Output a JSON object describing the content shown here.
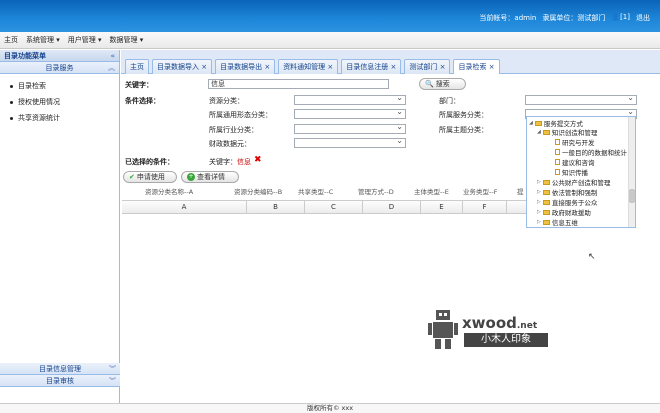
{
  "topbar": {
    "account_label": "当前帐号：",
    "account": "admin",
    "unit_label": "隶属单位：",
    "unit": "测试部门",
    "user_count": "[1]",
    "logout": "退出"
  },
  "menu": {
    "items": [
      "主页",
      "系统管理 ▾",
      "用户管理 ▾",
      "数据管理 ▾"
    ]
  },
  "sidebar": {
    "title": "目录功能菜单",
    "section": "目录服务",
    "items": [
      "目录检索",
      "授权使用情况",
      "共享资源统计"
    ],
    "bottom": [
      "目录信息管理",
      "目录审核"
    ]
  },
  "tabs": [
    {
      "label": "主页"
    },
    {
      "label": "目录数据导入 ×"
    },
    {
      "label": "目录数据导出 ×"
    },
    {
      "label": "资料通知管理 ×"
    },
    {
      "label": "目录信息注册 ×"
    },
    {
      "label": "测试部门 ×"
    },
    {
      "label": "目录检索 ×"
    }
  ],
  "form": {
    "keyword_label": "关键字：",
    "keyword_value": "信息",
    "search_btn": "搜索",
    "cond_label": "条件选择：",
    "res_cat": "资源分类：",
    "org_form": "所属通用形态分类：",
    "industry": "所属行业分类：",
    "open_value": "财政数据元：",
    "dept": "部门：",
    "service_cat": "所属服务分类：",
    "theme_cat": "所属主题分类：",
    "selected_label": "已选择的条件：",
    "kw_cond": "关键字：",
    "kw_cond_val": "信息",
    "apply_btn": "申请使用",
    "detail_btn": "查看详情"
  },
  "columns": [
    "资源分类名称--A",
    "资源分类编码--B",
    "共享类型--C",
    "管理方式--D",
    "主体类型--E",
    "业务类型--F",
    "提"
  ],
  "grid_headers": [
    "A",
    "B",
    "C",
    "D",
    "E",
    "F"
  ],
  "tree": {
    "nodes": [
      "服务提交方式",
      "知识创造和管理",
      "研究与开发",
      "一般目的的数据和统计",
      "建议和咨询",
      "知识传播",
      "公共财产创造和管理",
      "依法管制和强制",
      "直接服务于公众",
      "政府财政援助",
      "信息五维"
    ]
  },
  "footer": "版权所有© xxx",
  "watermark": {
    "brand": "xwood",
    "tld": ".net",
    "cn": "小木人印象"
  }
}
